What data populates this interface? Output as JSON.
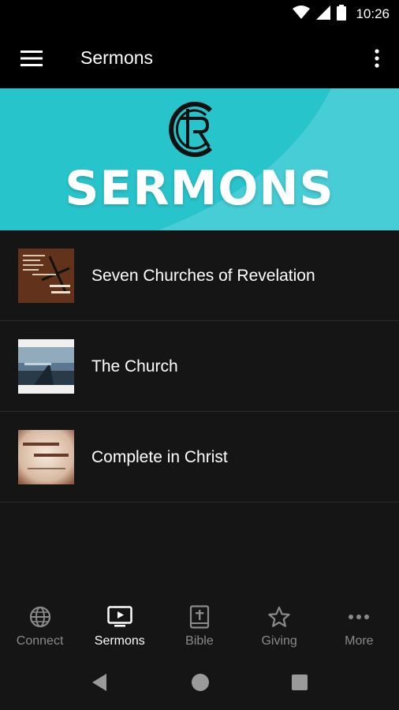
{
  "status_bar": {
    "time": "10:26",
    "icons": [
      "wifi-icon",
      "cell-signal-icon",
      "battery-icon"
    ]
  },
  "app_bar": {
    "title": "Sermons",
    "menu_icon": "hamburger-menu-icon",
    "overflow_icon": "more-vertical-icon"
  },
  "banner": {
    "logo_text": "CTR",
    "title": "SERMONS",
    "accent_color": "#28c4cc"
  },
  "sermons": [
    {
      "title": "Seven Churches of Revelation"
    },
    {
      "title": "The Church"
    },
    {
      "title": "Complete in Christ"
    }
  ],
  "bottom_nav": [
    {
      "label": "Connect",
      "icon": "globe-icon",
      "active": false
    },
    {
      "label": "Sermons",
      "icon": "tv-play-icon",
      "active": true
    },
    {
      "label": "Bible",
      "icon": "bible-icon",
      "active": false
    },
    {
      "label": "Giving",
      "icon": "star-icon",
      "active": false
    },
    {
      "label": "More",
      "icon": "more-horizontal-icon",
      "active": false
    }
  ],
  "system_nav": [
    "back-icon",
    "home-icon",
    "recents-icon"
  ]
}
